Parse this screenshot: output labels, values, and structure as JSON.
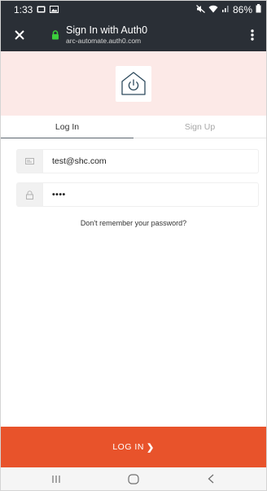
{
  "status_bar": {
    "time": "1:33",
    "battery": "86%",
    "icons": [
      "cast-icon",
      "image-icon",
      "mute-icon",
      "wifi-icon",
      "signal-icon",
      "battery-icon"
    ]
  },
  "browser_tab": {
    "title": "Sign In with Auth0",
    "url": "arc-automate.auth0.com",
    "icons": [
      "close-icon",
      "lock-icon",
      "more-vert-icon"
    ]
  },
  "colors": {
    "header_bg": "#2a2f36",
    "hero_bg": "#fce9e7",
    "accent": "#e8532b",
    "lock_green": "#3ccf3c"
  },
  "tabs": [
    {
      "label": "Log In",
      "active": true
    },
    {
      "label": "Sign Up",
      "active": false
    }
  ],
  "form": {
    "email": {
      "value": "test@shc.com",
      "icon": "envelope-icon"
    },
    "password": {
      "value": "••••",
      "icon": "padlock-icon"
    },
    "forgot_link": "Don't remember your password?"
  },
  "submit": {
    "label": "LOG IN",
    "chevron": "❯"
  },
  "nav": {
    "icons": [
      "recents-icon",
      "home-icon",
      "back-icon"
    ]
  }
}
